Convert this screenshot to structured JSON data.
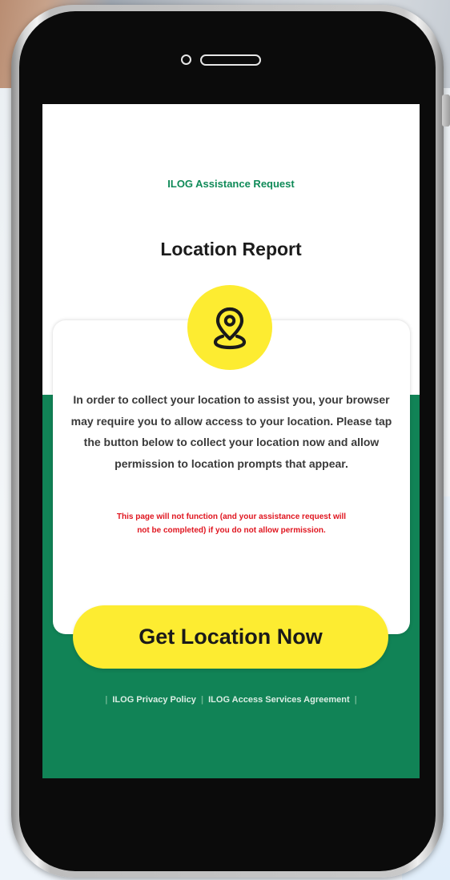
{
  "header": {
    "app_name": "ILOG Assistance Request",
    "page_title": "Location Report"
  },
  "card": {
    "icon": "location-pin-icon",
    "instructions": "In order to collect your location to assist you, your browser may require you to allow access to your location. Please tap the button below to collect your location now and allow permission to location prompts that appear.",
    "warning": "This page will not function (and your assistance request will not be completed) if you do not allow permission."
  },
  "actions": {
    "get_location_label": "Get Location Now"
  },
  "footer": {
    "links": [
      {
        "label": "ILOG Privacy Policy"
      },
      {
        "label": "ILOG Access Services Agreement"
      }
    ]
  },
  "colors": {
    "brand_green": "#118356",
    "accent_yellow": "#fdec31",
    "warning_red": "#e0151f"
  }
}
